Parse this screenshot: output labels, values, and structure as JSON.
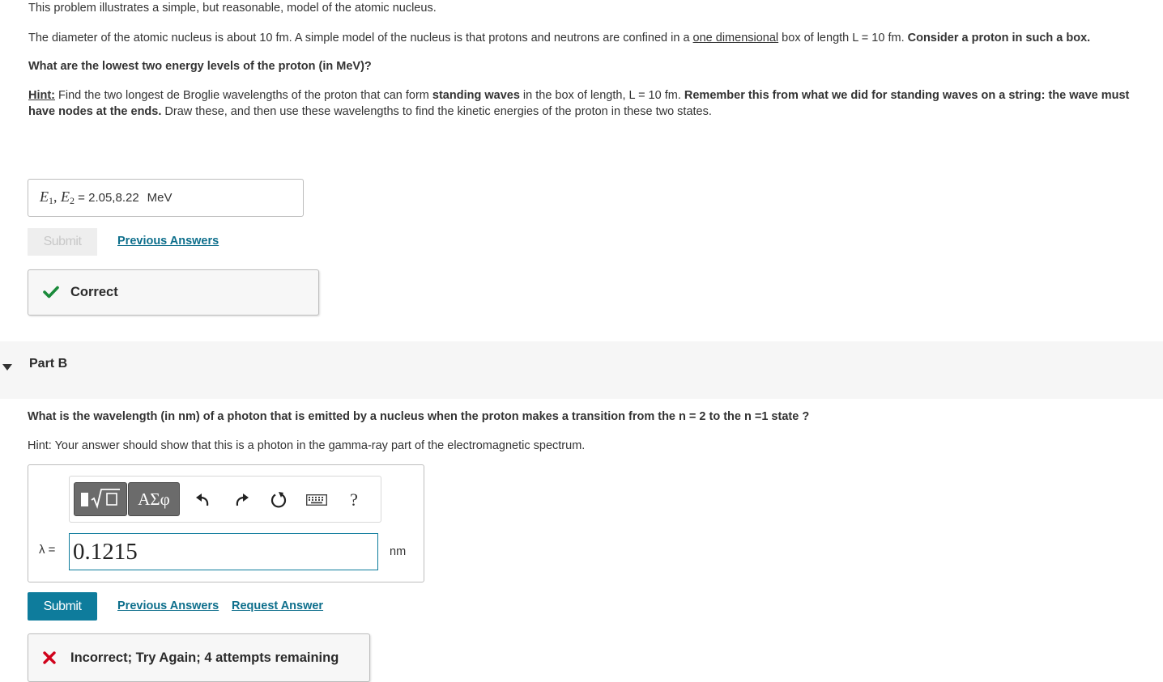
{
  "intro": {
    "line1": "This problem illustrates a simple, but reasonable, model of the atomic nucleus.",
    "p2_a": "The diameter of the atomic nucleus is about 10 fm. A simple model of the nucleus is that protons and neutrons are confined in a ",
    "p2_u": "one dimensional",
    "p2_b": " box of length L = 10 fm. ",
    "p2_bold": "Consider a proton in such a box.",
    "question_a": "What are the lowest two energy levels of the proton (in MeV)?",
    "hint_label": "Hint:",
    "hint_a": " Find the two longest de Broglie wavelengths of the proton that can form ",
    "hint_b_bold": "standing waves",
    "hint_c": " in the box of length, L = 10 fm. ",
    "hint_d_bold": "Remember this from what we did for standing waves on a string: the wave must have nodes at the ends.",
    "hint_e": " Draw these, and then use these wavelengths to find the kinetic energies of the proton in these two states."
  },
  "part_a": {
    "e1": "E",
    "e1_sub": "1",
    "sep": ", ",
    "e2": "E",
    "e2_sub": "2",
    "eq": " = ",
    "answer": "2.05,8.22",
    "unit": "MeV",
    "submit_label": "Submit",
    "previous_answers": "Previous Answers",
    "feedback": "Correct",
    "feedback_color": "#1a8a3a"
  },
  "part_b": {
    "title": "Part B",
    "question": "What is the wavelength (in nm) of a photon that is emitted by a nucleus when the proton makes a transition from the n = 2 to the n =1 state ?",
    "hint": "Hint: Your answer should show that this is a photon in the gamma-ray part of the electromagnetic spectrum.",
    "toolbar": {
      "templates_icon": "fraction-sqrt-icon",
      "symbols_label": "ΑΣφ",
      "undo_icon": "undo-icon",
      "redo_icon": "redo-icon",
      "reset_icon": "reset-icon",
      "keyboard_icon": "keyboard-icon",
      "help_label": "?"
    },
    "variable_label": "λ =",
    "input_value": "0.1215",
    "unit": "nm",
    "submit_label": "Submit",
    "previous_answers": "Previous Answers",
    "request_answer": "Request Answer",
    "feedback": "Incorrect; Try Again; 4 attempts remaining",
    "feedback_color": "#d0021b",
    "accent": "#0e7c9c"
  }
}
